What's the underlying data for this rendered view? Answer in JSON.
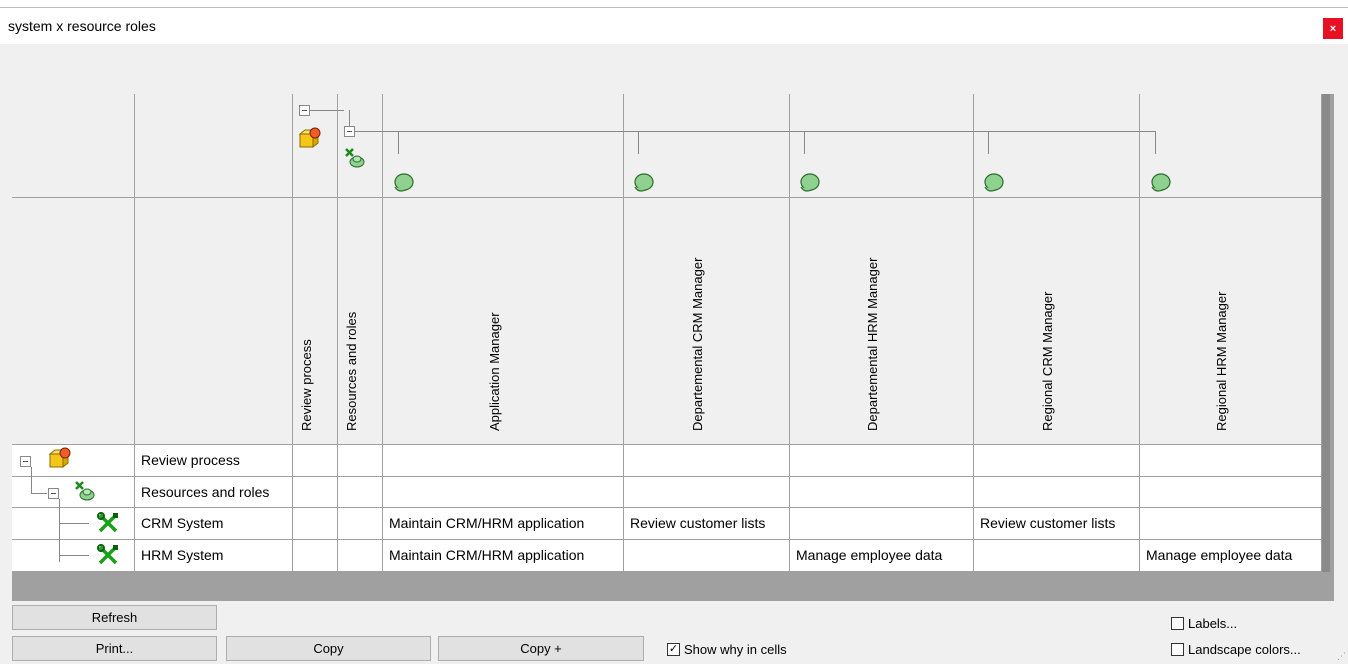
{
  "window": {
    "title": "system x resource roles",
    "close_glyph": "×"
  },
  "columns": [
    {
      "label": "Review process",
      "icon": "process-icon"
    },
    {
      "label": "Resources and roles",
      "icon": "resources-group-icon"
    },
    {
      "label": "Application Manager",
      "icon": "role-icon"
    },
    {
      "label": "Departemental CRM Manager",
      "icon": "role-icon"
    },
    {
      "label": "Departemental HRM Manager",
      "icon": "role-icon"
    },
    {
      "label": "Regional CRM Manager",
      "icon": "role-icon"
    },
    {
      "label": "Regional HRM Manager",
      "icon": "role-icon"
    }
  ],
  "rows": [
    {
      "label": "Review process",
      "icon": "process-icon",
      "cells": [
        "",
        "",
        "",
        "",
        "",
        "",
        ""
      ]
    },
    {
      "label": "Resources and roles",
      "icon": "resources-group-icon",
      "cells": [
        "",
        "",
        "",
        "",
        "",
        "",
        ""
      ]
    },
    {
      "label": "CRM System",
      "icon": "system-tools-icon",
      "cells": [
        "",
        "",
        "Maintain CRM/HRM application",
        "Review customer lists",
        "",
        "Review customer lists",
        ""
      ]
    },
    {
      "label": "HRM System",
      "icon": "system-tools-icon",
      "cells": [
        "",
        "",
        "Maintain CRM/HRM application",
        "",
        "Manage employee data",
        "",
        "Manage employee data"
      ]
    }
  ],
  "buttons": {
    "refresh": "Refresh",
    "print": "Print...",
    "copy": "Copy",
    "copy_plus": "Copy +"
  },
  "checkboxes": {
    "show_why": {
      "label": "Show why in cells",
      "checked": true
    },
    "labels": {
      "label": "Labels...",
      "checked": false
    },
    "landscape_colors": {
      "label": "Landscape colors...",
      "checked": false
    }
  },
  "colors": {
    "role": "#8fd18f",
    "process": "#f5c518",
    "close": "#e81123"
  }
}
